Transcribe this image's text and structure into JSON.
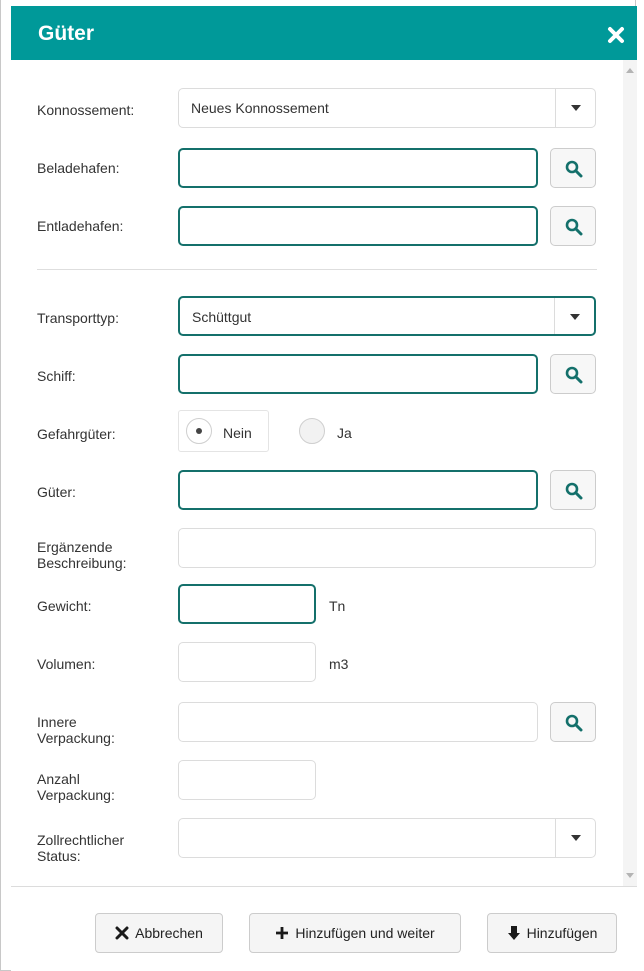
{
  "dialog": {
    "title": "Güter",
    "close_icon": "close-x-icon",
    "header_color": "#009999",
    "focus_border_color": "#14706b"
  },
  "form": {
    "konnossement": {
      "label": "Konnossement:",
      "value": "Neues Konnossement"
    },
    "beladehafen": {
      "label": "Beladehafen:",
      "value": ""
    },
    "entladehafen": {
      "label": "Entladehafen:",
      "value": ""
    },
    "transporttyp": {
      "label": "Transporttyp:",
      "value": "Schüttgut"
    },
    "schiff": {
      "label": "Schiff:",
      "value": ""
    },
    "gefahrgueter": {
      "label": "Gefahrgüter:",
      "options": [
        "Nein",
        "Ja"
      ],
      "selected": "Nein"
    },
    "gueter": {
      "label": "Güter:",
      "value": ""
    },
    "beschreibung": {
      "label_line1": "Ergänzende",
      "label_line2": "Beschreibung:",
      "value": ""
    },
    "gewicht": {
      "label": "Gewicht:",
      "value": "",
      "unit": "Tn"
    },
    "volumen": {
      "label": "Volumen:",
      "value": "",
      "unit": "m3"
    },
    "innere_verpackung": {
      "label_line1": "Innere",
      "label_line2": "Verpackung:",
      "value": ""
    },
    "anzahl_verpackung": {
      "label_line1": "Anzahl",
      "label_line2": "Verpackung:",
      "value": ""
    },
    "zollstatus": {
      "label_line1": "Zollrechtlicher",
      "label_line2": "Status:",
      "value": ""
    }
  },
  "footer": {
    "cancel_label": "Abbrechen",
    "add_continue_label": "Hinzufügen und weiter",
    "add_label": "Hinzufügen"
  }
}
